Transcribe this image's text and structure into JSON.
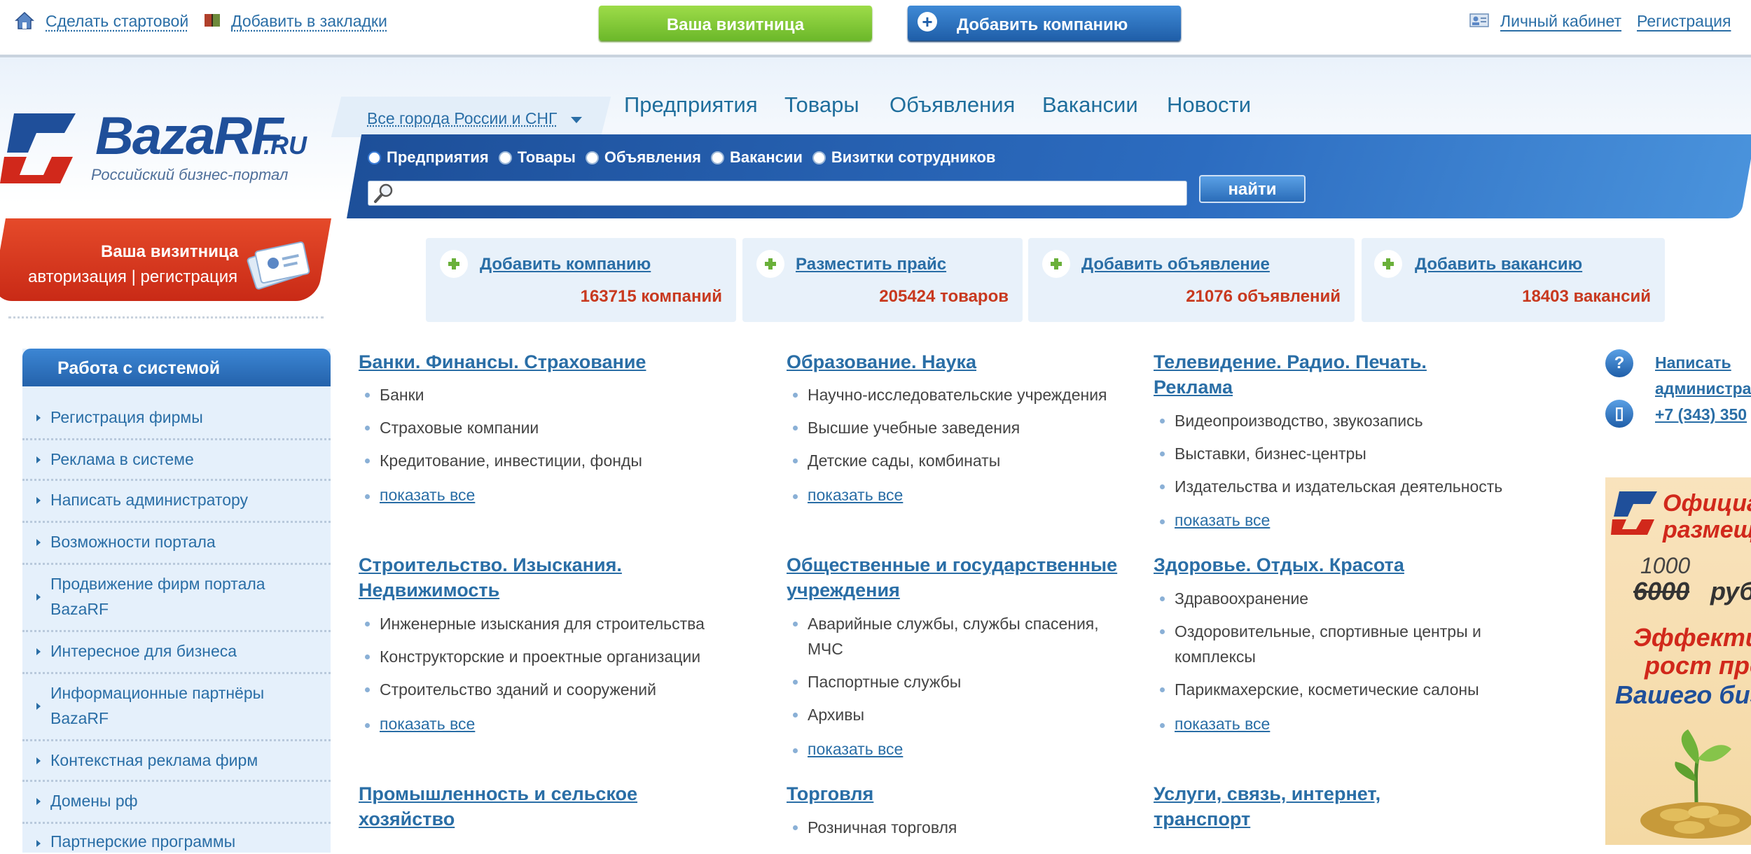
{
  "topbar": {
    "make_start": "Сделать стартовой",
    "add_bookmarks": "Добавить в закладки",
    "vizitnica_btn": "Ваша визитница",
    "add_company_btn": "Добавить компанию",
    "cabinet": "Личный кабинет",
    "register": "Регистрация"
  },
  "logo": {
    "name": "BazaRF",
    "suffix": "RU",
    "subtitle": "Российский бизнес-портал"
  },
  "city_select": "Все города России и СНГ",
  "mainnav": [
    "Предприятия",
    "Товары",
    "Объявления",
    "Вакансии",
    "Новости"
  ],
  "search": {
    "radios": [
      {
        "label": "Предприятия",
        "checked": true
      },
      {
        "label": "Товары",
        "checked": false
      },
      {
        "label": "Объявления",
        "checked": false
      },
      {
        "label": "Вакансии",
        "checked": false
      },
      {
        "label": "Визитки сотрудников",
        "checked": false
      }
    ],
    "button": "найти"
  },
  "visit_card": {
    "title": "Ваша визитница",
    "links": "авторизация | регистрация"
  },
  "stats": [
    {
      "link": "Добавить компанию",
      "count": "163715 компаний"
    },
    {
      "link": "Разместить прайс",
      "count": "205424 товаров"
    },
    {
      "link": "Добавить объявление",
      "count": "21076 объявлений"
    },
    {
      "link": "Добавить вакансию",
      "count": "18403 вакансий"
    }
  ],
  "sidebar": {
    "title": "Работа с системой",
    "items": [
      "Регистрация фирмы",
      "Реклама в системе",
      "Написать администратору",
      "Возможности портала",
      "Продвижение фирм портала BazaRF",
      "Интересное для бизнеса",
      "Информационные партнёры BazaRF",
      "Контекстная реклама фирм",
      "Домены рф",
      "Партнерские программы"
    ]
  },
  "categories": {
    "banks": {
      "title": "Банки. Финансы. Страхование",
      "items": [
        "Банки",
        "Страховые компании",
        "Кредитование, инвестиции, фонды"
      ],
      "show_all": "показать все"
    },
    "education": {
      "title": "Образование. Наука",
      "items": [
        "Научно-исследовательские учреждения",
        "Высшие учебные заведения",
        "Детские сады, комбинаты"
      ],
      "show_all": "показать все"
    },
    "media": {
      "title_line1": "Телевидение. Радио. Печать.",
      "title_line2": "Реклама",
      "items": [
        "Видеопроизводство, звукозапись",
        "Выставки, бизнес-центры",
        "Издательства и издательская деятельность"
      ],
      "show_all": "показать все"
    },
    "construction": {
      "title_line1": "Строительство. Изыскания.",
      "title_line2": "Недвижимость",
      "items": [
        "Инженерные изыскания для строительства",
        "Конструкторские и проектные организации",
        "Строительство зданий и сооружений"
      ],
      "show_all": "показать все"
    },
    "public": {
      "title_line1": "Общественные и государственные",
      "title_line2": "учреждения",
      "items_line1": "Аварийные службы, службы спасения,",
      "items_line2": "МЧС",
      "items": [
        "Паспортные службы",
        "Архивы"
      ],
      "show_all": "показать все"
    },
    "health": {
      "title": "Здоровье. Отдых. Красота",
      "items": [
        "Здравоохранение"
      ],
      "item2_line1": "Оздоровительные, спортивные центры и",
      "item2_line2": "комплексы",
      "item3": "Парикмахерские, косметические салоны",
      "show_all": "показать все"
    },
    "industry": {
      "title_line1": "Промышленность и сельское",
      "title_line2": "хозяйство"
    },
    "trade": {
      "title": "Торговля",
      "items": [
        "Розничная торговля"
      ]
    },
    "services": {
      "title_line1": "Услуги, связь, интернет,",
      "title_line2": "транспорт"
    }
  },
  "right": {
    "write_line1": "Написать",
    "write_line2": "администратору",
    "phone": "+7 (343) 350",
    "ad_red1": "Официальное",
    "ad_red1b": "размещение",
    "ad_old_price": "6000",
    "ad_new_price": "1000",
    "ad_rub": "руб",
    "ad_eff": "Эффективный",
    "ad_growth": "рост продаж",
    "ad_business": "Вашего бизнеса"
  },
  "colors": {
    "accent_blue": "#2a6ea6",
    "accent_red": "#c8391f",
    "accent_green": "#6ab03a"
  }
}
